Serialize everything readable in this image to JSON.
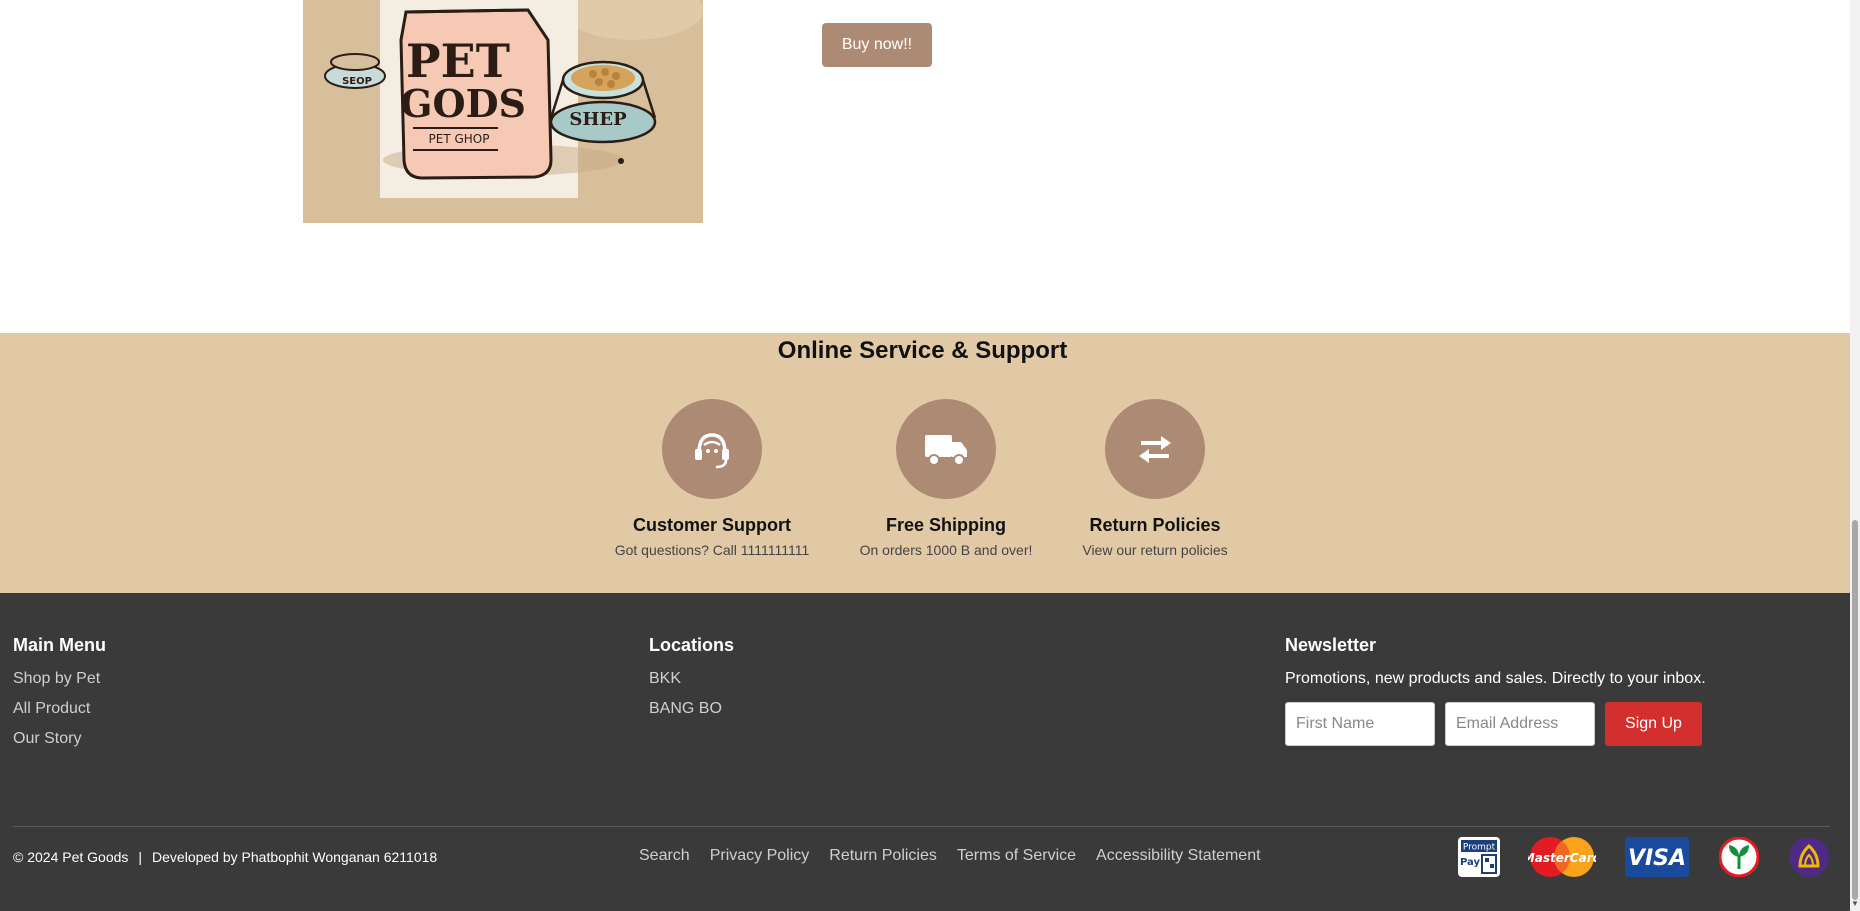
{
  "product": {
    "image_alt": "Pet Gods pet shop illustration",
    "bag_line1": "PET",
    "bag_line2": "GODS",
    "bag_line3": "PET GHOP",
    "bowl_label": "SHEP",
    "small_bowl_label": "SEOP",
    "buy_label": "Buy now!!"
  },
  "support": {
    "title": "Online Service & Support",
    "items": [
      {
        "icon": "headset-icon",
        "title": "Customer Support",
        "desc": "Got questions? Call 1111111111"
      },
      {
        "icon": "truck-icon",
        "title": "Free Shipping",
        "desc": "On orders 1000 B and over!"
      },
      {
        "icon": "exchange-arrows-icon",
        "title": "Return Policies",
        "desc": "View our return policies"
      }
    ]
  },
  "footer": {
    "main_menu": {
      "title": "Main Menu",
      "links": [
        "Shop by Pet",
        "All Product",
        "Our Story"
      ]
    },
    "locations": {
      "title": "Locations",
      "links": [
        "BKK",
        "BANG BO"
      ]
    },
    "newsletter": {
      "title": "Newsletter",
      "desc": "Promotions, new products and sales. Directly to your inbox.",
      "first_name_placeholder": "First Name",
      "email_placeholder": "Email Address",
      "signup_label": "Sign Up"
    },
    "copyright": "© 2024 Pet Goods",
    "separator": "|",
    "developer": "Developed by Phatbophit Wonganan 6211018",
    "bottom_links": [
      "Search",
      "Privacy Policy",
      "Return Policies",
      "Terms of Service",
      "Accessibility Statement"
    ],
    "payments": {
      "promptpay_line1": "Prompt",
      "promptpay_line2": "Pay",
      "mastercard": "MasterCard",
      "visa": "VISA"
    }
  },
  "colors": {
    "accent_brown": "#ad8a73",
    "support_bg": "#e2c9a6",
    "footer_bg": "#3b3a3a",
    "signup_red": "#d32f2f"
  }
}
